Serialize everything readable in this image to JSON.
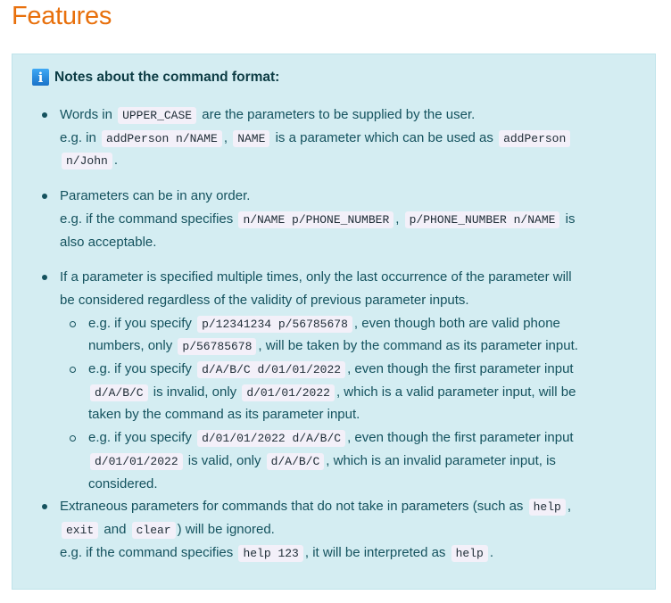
{
  "heading": "Features",
  "note": {
    "icon": "info-icon",
    "title": "Notes about the command format:",
    "lines": [
      {
        "level": 1,
        "bullet": true,
        "segs": [
          {
            "t": "Words in "
          },
          {
            "c": "UPPER_CASE"
          },
          {
            "t": " are the parameters to be supplied by the user."
          }
        ]
      },
      {
        "level": 1,
        "segs": [
          {
            "t": "e.g. in "
          },
          {
            "c": "addPerson n/NAME"
          },
          {
            "t": ", "
          },
          {
            "c": "NAME"
          },
          {
            "t": " is a parameter which can be used as "
          },
          {
            "c": "addPerson"
          }
        ]
      },
      {
        "level": 1,
        "segs": [
          {
            "c": "n/John"
          },
          {
            "t": "."
          }
        ]
      },
      {
        "level": 1,
        "bullet": true,
        "gap": true,
        "segs": [
          {
            "t": "Parameters can be in any order."
          }
        ]
      },
      {
        "level": 1,
        "segs": [
          {
            "t": "e.g. if the command specifies "
          },
          {
            "c": "n/NAME p/PHONE_NUMBER"
          },
          {
            "t": ", "
          },
          {
            "c": "p/PHONE_NUMBER n/NAME"
          },
          {
            "t": " is"
          }
        ]
      },
      {
        "level": 1,
        "segs": [
          {
            "t": "also acceptable."
          }
        ]
      },
      {
        "level": 1,
        "bullet": true,
        "gap": true,
        "segs": [
          {
            "t": "If a parameter is specified multiple times, only the last occurrence of the parameter will"
          }
        ]
      },
      {
        "level": 1,
        "segs": [
          {
            "t": "be considered regardless of the validity of previous parameter inputs."
          }
        ]
      },
      {
        "level": 2,
        "bullet": true,
        "segs": [
          {
            "t": "e.g. if you specify "
          },
          {
            "c": "p/12341234 p/56785678"
          },
          {
            "t": ", even though both are valid phone"
          }
        ]
      },
      {
        "level": 2,
        "segs": [
          {
            "t": "numbers, only "
          },
          {
            "c": "p/56785678"
          },
          {
            "t": ", will be taken by the command as its parameter input."
          }
        ]
      },
      {
        "level": 2,
        "bullet": true,
        "segs": [
          {
            "t": "e.g. if you specify "
          },
          {
            "c": "d/A/B/C d/01/01/2022"
          },
          {
            "t": ", even though the first parameter input"
          }
        ]
      },
      {
        "level": 2,
        "segs": [
          {
            "c": "d/A/B/C"
          },
          {
            "t": " is invalid, only "
          },
          {
            "c": "d/01/01/2022"
          },
          {
            "t": ", which is a valid parameter input, will be"
          }
        ]
      },
      {
        "level": 2,
        "segs": [
          {
            "t": "taken by the command as its parameter input."
          }
        ]
      },
      {
        "level": 2,
        "bullet": true,
        "segs": [
          {
            "t": "e.g. if you specify "
          },
          {
            "c": "d/01/01/2022 d/A/B/C"
          },
          {
            "t": ", even though the first parameter input"
          }
        ]
      },
      {
        "level": 2,
        "segs": [
          {
            "c": "d/01/01/2022"
          },
          {
            "t": " is valid, only "
          },
          {
            "c": "d/A/B/C"
          },
          {
            "t": ", which is an invalid parameter input, is"
          }
        ]
      },
      {
        "level": 2,
        "segs": [
          {
            "t": "considered."
          }
        ]
      },
      {
        "level": 1,
        "bullet": true,
        "segs": [
          {
            "t": "Extraneous parameters for commands that do not take in parameters (such as "
          },
          {
            "c": "help"
          },
          {
            "t": ","
          }
        ]
      },
      {
        "level": 1,
        "segs": [
          {
            "c": "exit"
          },
          {
            "t": " and "
          },
          {
            "c": "clear"
          },
          {
            "t": ") will be ignored."
          }
        ]
      },
      {
        "level": 1,
        "segs": [
          {
            "t": "e.g. if the command specifies "
          },
          {
            "c": "help 123"
          },
          {
            "t": ", it will be interpreted as "
          },
          {
            "c": "help"
          },
          {
            "t": "."
          }
        ]
      }
    ]
  }
}
